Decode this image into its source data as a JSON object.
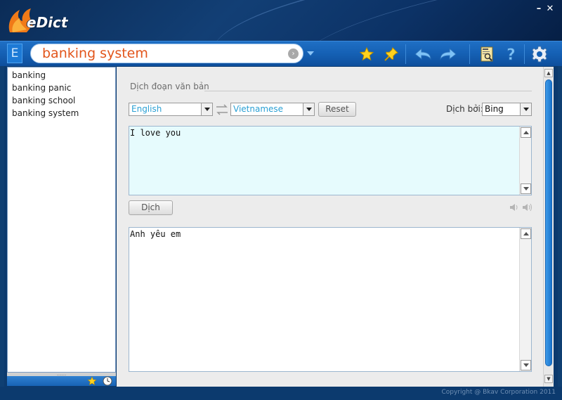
{
  "app": {
    "name": "eDict",
    "window_buttons": {
      "minimize": "–",
      "close": "✕"
    }
  },
  "toolbar": {
    "lang_badge": "E",
    "search_value": "banking system",
    "icons": [
      "star-icon",
      "pin-icon",
      "back-arrow-icon",
      "forward-arrow-icon",
      "dictionary-book-icon",
      "help-icon",
      "settings-gear-icon"
    ]
  },
  "sidebar": {
    "items": [
      {
        "label": "banking"
      },
      {
        "label": "banking panic"
      },
      {
        "label": "banking school"
      },
      {
        "label": "banking system"
      }
    ],
    "grip": "......"
  },
  "translate": {
    "section_title": "Dịch đoạn văn bản",
    "source_lang": "English",
    "target_lang": "Vietnamese",
    "reset_label": "Reset",
    "translate_by_label": "Dịch bởi:",
    "engine": "Bing",
    "input_text": "I love you",
    "translate_button": "Dịch",
    "output_text": "Anh yêu em"
  },
  "footer": {
    "copyright": "Copyright @ Bkav Corporation 2011"
  },
  "colors": {
    "accent": "#1560b4",
    "search_text": "#e2551b",
    "lang_select_text": "#2aa0d4",
    "input_bg": "#e6fbfd"
  }
}
